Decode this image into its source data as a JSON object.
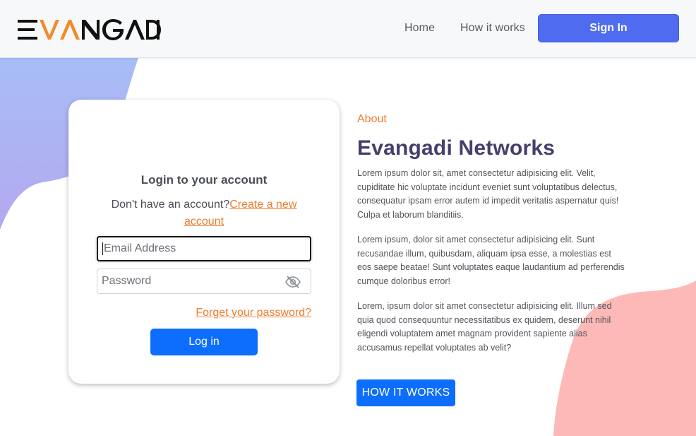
{
  "colors": {
    "accent_orange": "#ee7d2d",
    "signin_blue": "#4f6cf0",
    "primary_blue": "#0d6efd",
    "title_purple": "#453f6e",
    "blob_blue": "#a8b6f5",
    "blob_pink": "#fdb8b6"
  },
  "header": {
    "logo_text": "EVANGADI",
    "nav": {
      "home": "Home",
      "how_it_works": "How it works"
    },
    "signin_label": "Sign In"
  },
  "login": {
    "title": "Login to your account",
    "no_account_text": "Don't have an account?",
    "create_link": "Create a new account",
    "email_placeholder": "Email Address",
    "password_placeholder": "Password",
    "password_icon": "eye-slash-icon",
    "forgot_link": "Forget your password?",
    "login_button": "Log in"
  },
  "about": {
    "label": "About",
    "title": "Evangadi Networks",
    "paragraphs": [
      "Lorem ipsum dolor sit, amet consectetur adipisicing elit. Velit, cupiditate hic voluptate incidunt eveniet sunt voluptatibus delectus, consequatur ipsam error autem id impedit veritatis aspernatur quis! Culpa et laborum blanditiis.",
      "Lorem ipsum, dolor sit amet consectetur adipisicing elit. Sunt recusandae illum, quibusdam, aliquam ipsa esse, a molestias est eos saepe beatae! Sunt voluptates eaque laudantium ad perferendis cumque doloribus error!",
      "Lorem, ipsum dolor sit amet consectetur adipisicing elit. Illum sed quia quod consequuntur necessitatibus ex quidem, deserunt nihil eligendi voluptatem amet magnam provident sapiente alias accusamus repellat voluptates ab velit?"
    ],
    "how_button": "HOW IT WORKS"
  }
}
